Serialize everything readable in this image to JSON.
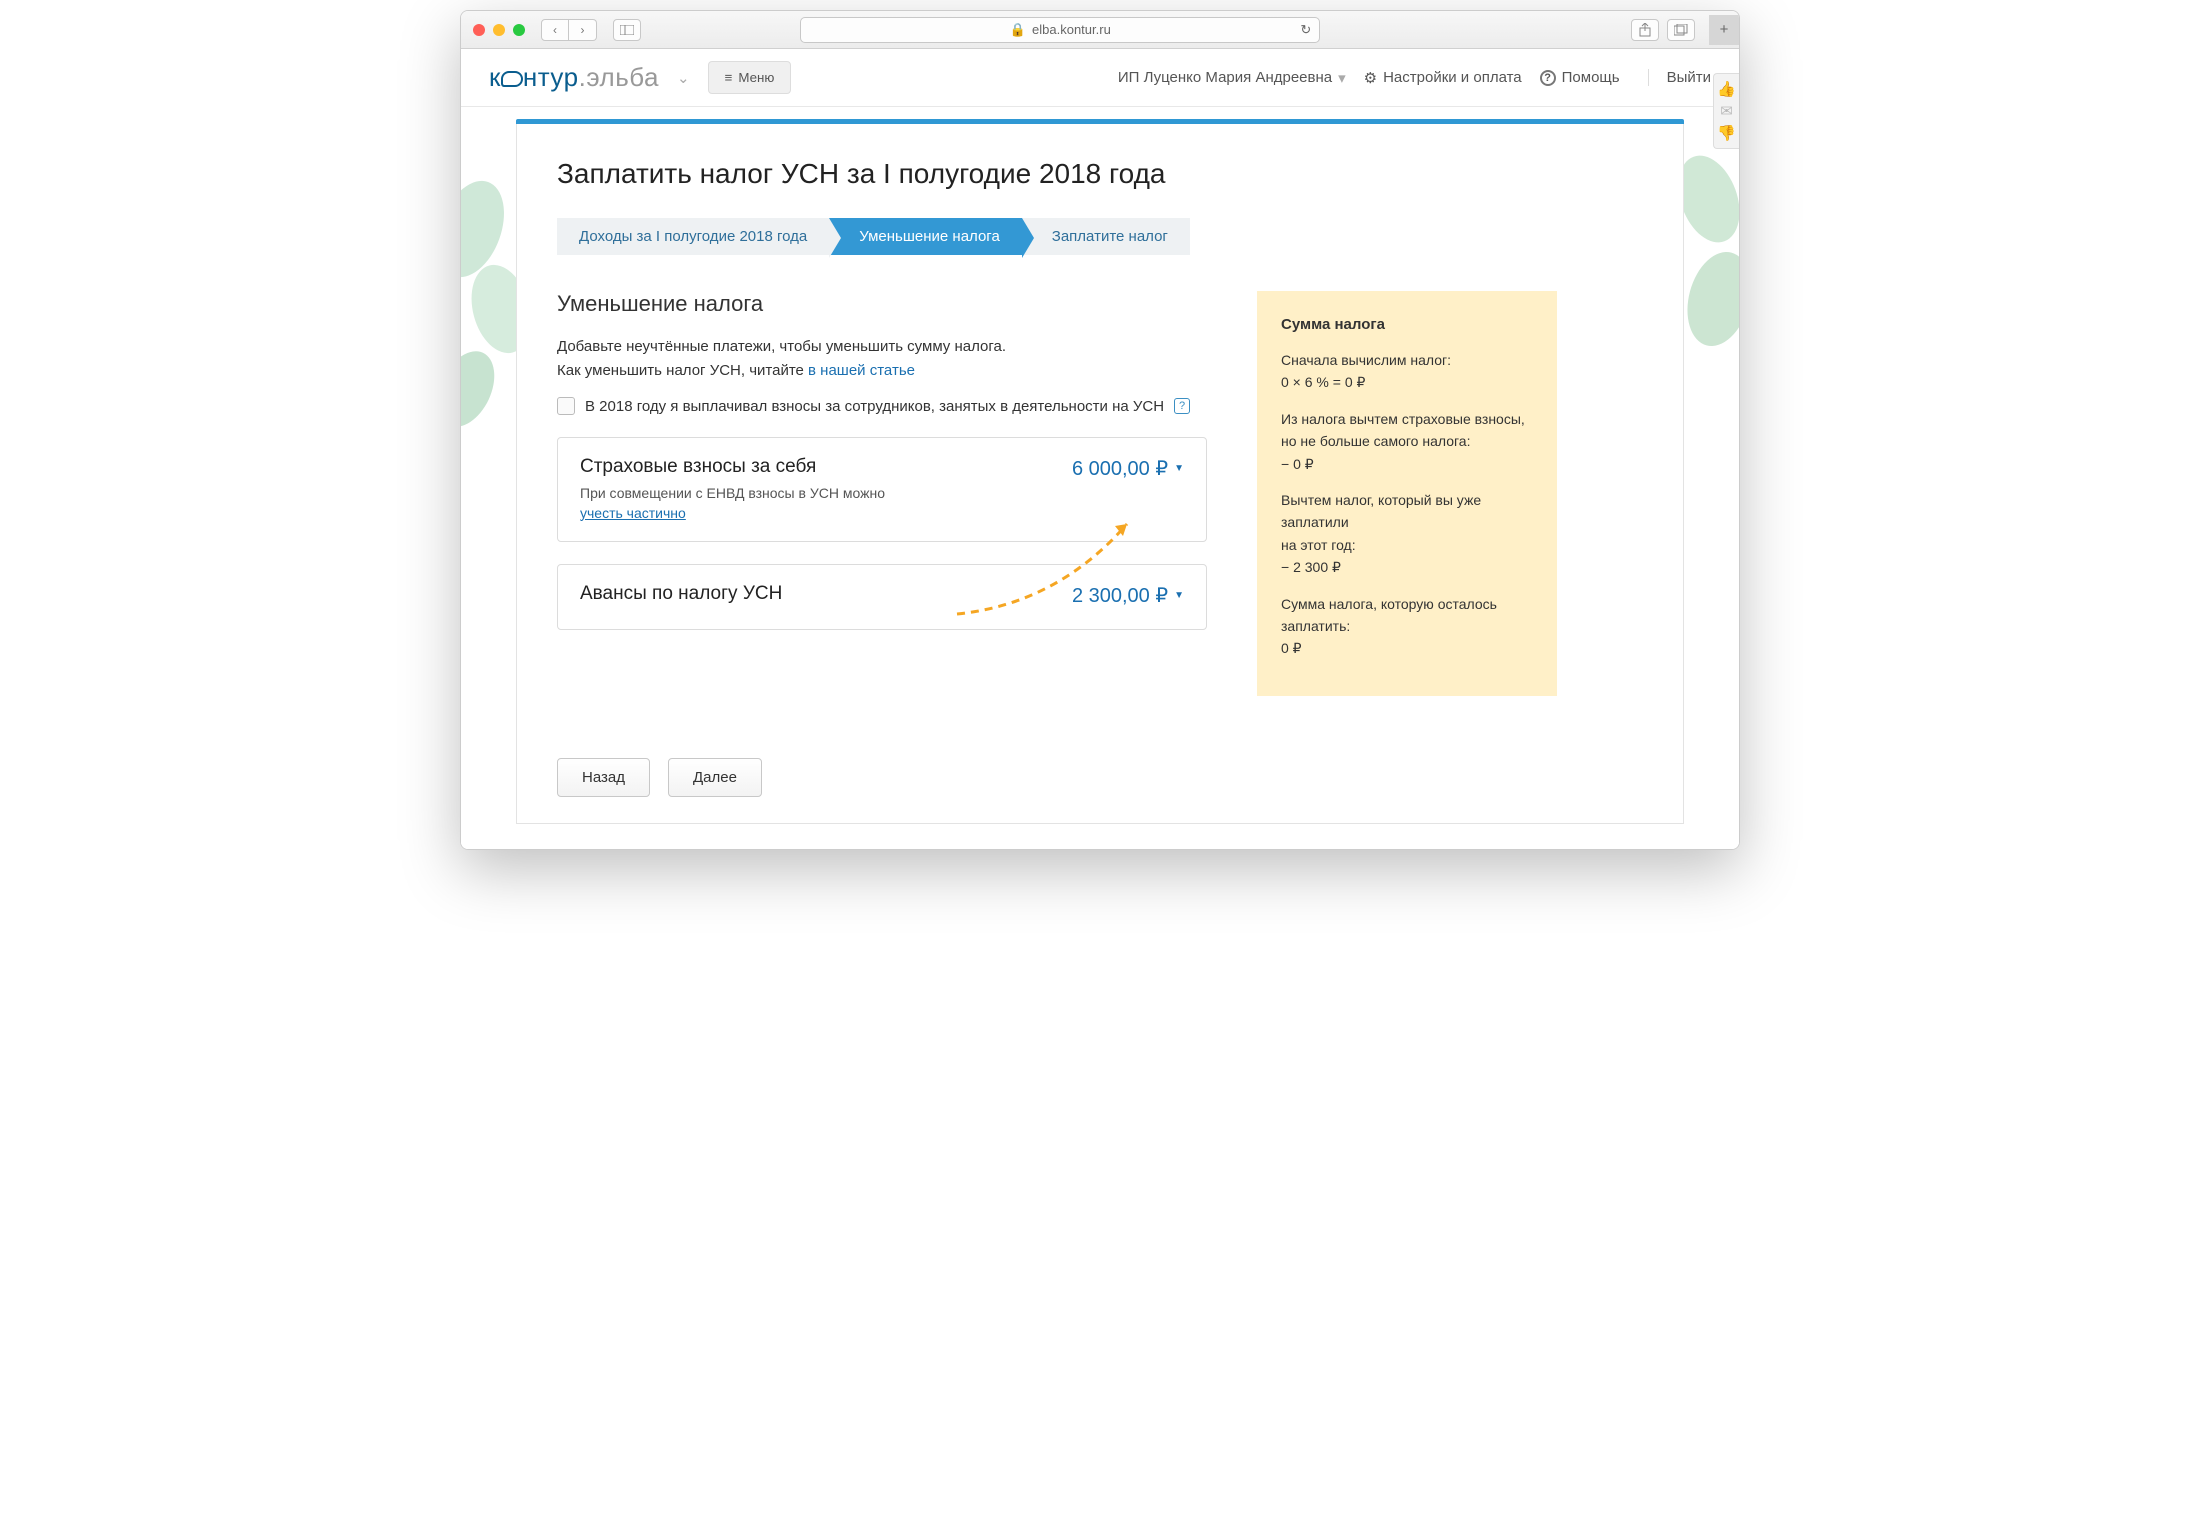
{
  "browser": {
    "url": "elba.kontur.ru"
  },
  "logo": {
    "brand1": "к",
    "brand2": "нтур",
    "sep": ".",
    "brand3": "эльба"
  },
  "nav": {
    "menu": "Меню",
    "user": "ИП Луценко Мария Андреевна",
    "settings": "Настройки и оплата",
    "help": "Помощь",
    "exit": "Выйти"
  },
  "page": {
    "title": "Заплатить налог УСН за I полугодие 2018 года",
    "steps": [
      "Доходы за I полугодие 2018 года",
      "Уменьшение налога",
      "Заплатите налог"
    ],
    "h2": "Уменьшение налога",
    "hint1": "Добавьте неучтённые платежи, чтобы уменьшить сумму налога.",
    "hint2a": "Как уменьшить налог УСН, читайте ",
    "hint2b": "в нашей статье",
    "checkbox": "В 2018 году я выплачивал взносы за сотрудников, занятых в деятельности на УСН",
    "panel1": {
      "title": "Страховые взносы за себя",
      "sub1": "При совмещении с ЕНВД взносы в УСН можно",
      "sub2": "учесть частично",
      "amount": "6 000,00 ₽"
    },
    "panel2": {
      "title": "Авансы по налогу УСН",
      "amount": "2 300,00 ₽"
    },
    "sidebar": {
      "title": "Сумма налога",
      "l1": "Сначала вычислим налог:",
      "l2": "0 × 6 % = 0 ₽",
      "l3": "Из налога вычтем страховые взносы,",
      "l4": "но не больше самого налога:",
      "l5": "− 0 ₽",
      "l6": "Вычтем налог, который вы уже заплатили",
      "l7": "на этот год:",
      "l8": "− 2 300 ₽",
      "l9": "Сумма налога, которую осталось заплатить:",
      "l10": "0 ₽"
    },
    "back": "Назад",
    "next": "Далее"
  }
}
